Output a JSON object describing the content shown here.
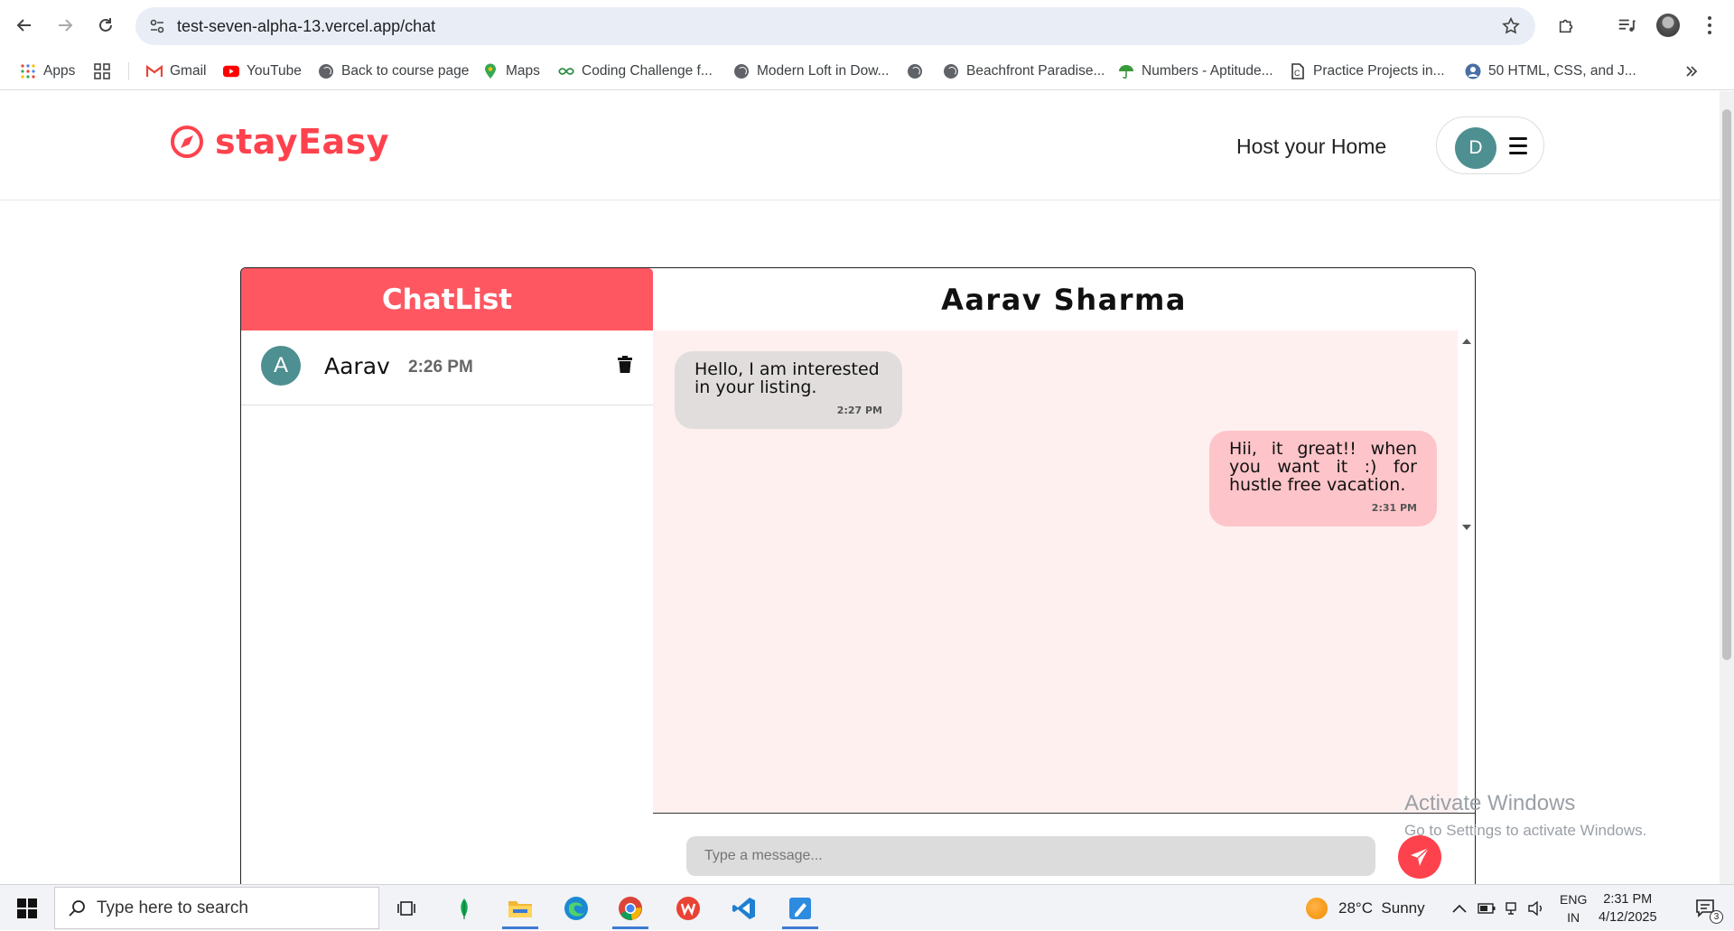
{
  "browser": {
    "url": "test-seven-alpha-13.vercel.app/chat",
    "bookmarks": [
      {
        "label": "Apps",
        "icon": "apps-grid-icon"
      },
      {
        "label": "",
        "icon": "tab-groups-icon"
      },
      {
        "label": "Gmail",
        "icon": "gmail-icon"
      },
      {
        "label": "YouTube",
        "icon": "youtube-icon"
      },
      {
        "label": "Back to course page",
        "icon": "globe-icon"
      },
      {
        "label": "Maps",
        "icon": "maps-pin-icon"
      },
      {
        "label": "Coding Challenge f...",
        "icon": "coding-icon"
      },
      {
        "label": "Modern Loft in Dow...",
        "icon": "globe-icon"
      },
      {
        "label": "",
        "icon": "globe-icon"
      },
      {
        "label": "Beachfront Paradise...",
        "icon": "globe-icon"
      },
      {
        "label": "Numbers - Aptitude...",
        "icon": "umbrella-icon"
      },
      {
        "label": "Practice Projects in...",
        "icon": "document-icon"
      },
      {
        "label": "50 HTML, CSS, and J...",
        "icon": "person-icon"
      }
    ]
  },
  "site": {
    "brand": "stayEasy",
    "host_link": "Host your Home",
    "user_initial": "D"
  },
  "chat": {
    "list_title": "ChatList",
    "active_contact": "Aarav Sharma",
    "items": [
      {
        "initial": "A",
        "name": "Aarav",
        "time": "2:26 PM"
      }
    ],
    "messages": [
      {
        "direction": "incoming",
        "text": "Hello, I am interested in your listing.",
        "time": "2:27 PM"
      },
      {
        "direction": "outgoing",
        "text": "Hii, it great!! when you want it :) for hustle free vacation.",
        "time": "2:31 PM"
      }
    ],
    "input_placeholder": "Type a message..."
  },
  "watermark": {
    "line1": "Activate Windows",
    "line2": "Go to Settings to activate Windows."
  },
  "taskbar": {
    "search_placeholder": "Type here to search",
    "weather": "28°C  Sunny",
    "lang_line1": "ENG",
    "lang_line2": "IN",
    "time": "2:31 PM",
    "date": "4/12/2025",
    "notification_count": "3"
  },
  "colors": {
    "brand": "#fe424d",
    "chatlist_header": "#fe5761",
    "avatar": "#4e8f91",
    "outgoing_bubble": "#fdc4c9",
    "incoming_bubble": "#e1dddd",
    "messages_bg": "#fff0f0"
  }
}
